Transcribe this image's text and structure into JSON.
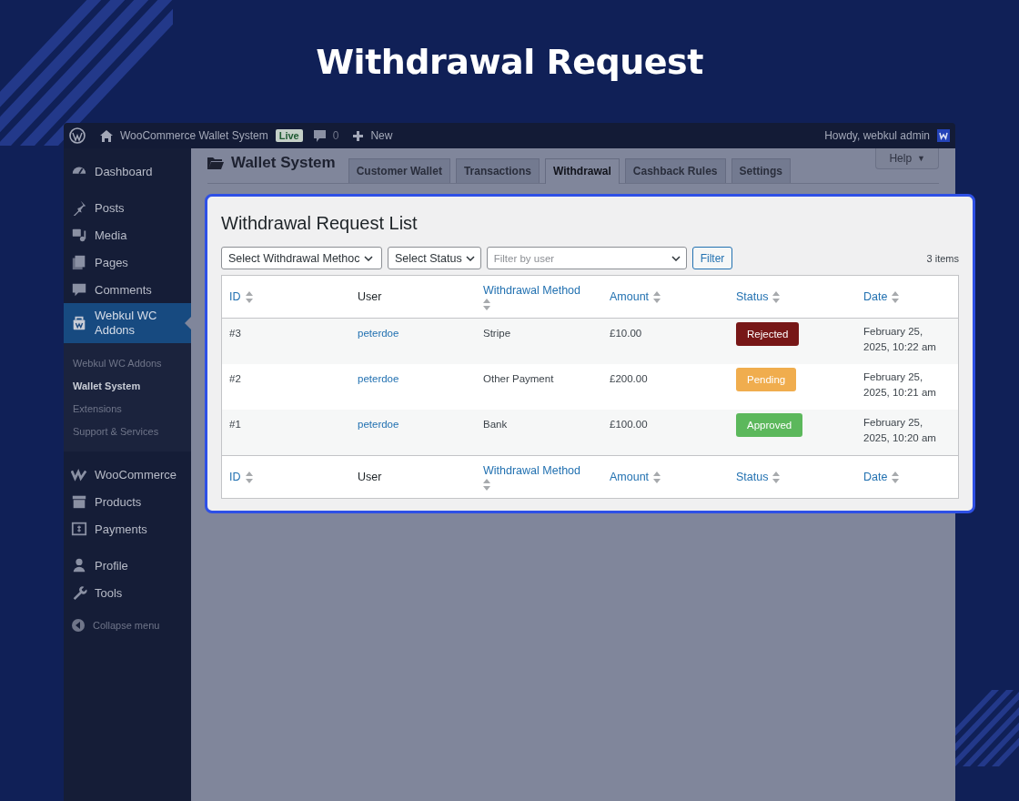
{
  "headline": "Withdrawal Request",
  "admin_bar": {
    "site": "WooCommerce Wallet System",
    "env_badge": "Live",
    "comments": "0",
    "new_label": "New",
    "greeting": "Howdy, webkul admin"
  },
  "sidebar": {
    "groups": [
      {
        "items": [
          {
            "label": "Dashboard",
            "selected": false
          }
        ]
      },
      {
        "items": [
          {
            "label": "Posts",
            "selected": false
          },
          {
            "label": "Media",
            "selected": false
          },
          {
            "label": "Pages",
            "selected": false
          },
          {
            "label": "Comments",
            "selected": false
          },
          {
            "label": "Webkul WC Addons",
            "selected": true,
            "children": [
              {
                "label": "Webkul WC Addons",
                "selected": false
              },
              {
                "label": "Wallet System",
                "selected": true
              },
              {
                "label": "Extensions",
                "selected": false
              },
              {
                "label": "Support & Services",
                "selected": false
              }
            ]
          }
        ]
      },
      {
        "items": [
          {
            "label": "WooCommerce",
            "selected": false
          },
          {
            "label": "Products",
            "selected": false
          },
          {
            "label": "Payments",
            "selected": false
          }
        ]
      },
      {
        "items": [
          {
            "label": "Profile",
            "selected": false
          },
          {
            "label": "Tools",
            "selected": false
          }
        ]
      }
    ],
    "collapse_label": "Collapse menu"
  },
  "page": {
    "title": "Wallet System",
    "help_label": "Help",
    "help_caret": "▼",
    "tabs": [
      {
        "label": "Customer Wallet",
        "selected": false
      },
      {
        "label": "Transactions",
        "selected": false
      },
      {
        "label": "Withdrawal",
        "selected": true
      },
      {
        "label": "Cashback Rules",
        "selected": false
      },
      {
        "label": "Settings",
        "selected": false
      }
    ]
  },
  "card": {
    "title": "Withdrawal Request List",
    "filters": {
      "method_select": "Select Withdrawal Methoc",
      "status_select": "Select Status",
      "user_placeholder": "Filter by user",
      "button": "Filter"
    },
    "count": "3 items",
    "columns": [
      {
        "label": "ID",
        "sortable": true
      },
      {
        "label": "User",
        "sortable": false
      },
      {
        "label": "Withdrawal Method",
        "sortable": true
      },
      {
        "label": "Amount",
        "sortable": true
      },
      {
        "label": "Status",
        "sortable": true
      },
      {
        "label": "Date",
        "sortable": true
      }
    ],
    "rows": [
      {
        "id": "#3",
        "user": "peterdoe",
        "method": "Stripe",
        "amount": "£10.00",
        "status": "Rejected",
        "color": "#771717",
        "date": "February 25, 2025, 10:22 am"
      },
      {
        "id": "#2",
        "user": "peterdoe",
        "method": "Other Payment",
        "amount": "£200.00",
        "status": "Pending",
        "color": "#f0ad4e",
        "date": "February 25, 2025, 10:21 am"
      },
      {
        "id": "#1",
        "user": "peterdoe",
        "method": "Bank",
        "amount": "£100.00",
        "status": "Approved",
        "color": "#5cb85c",
        "date": "February 25, 2025, 10:20 am"
      }
    ],
    "footer_columns": [
      {
        "label": "ID",
        "sortable": true
      },
      {
        "label": "User",
        "sortable": false
      },
      {
        "label": "Withdrawal Method",
        "sortable": true
      },
      {
        "label": "Amount",
        "sortable": true
      },
      {
        "label": "Status",
        "sortable": true
      },
      {
        "label": "Date",
        "sortable": true
      }
    ]
  }
}
